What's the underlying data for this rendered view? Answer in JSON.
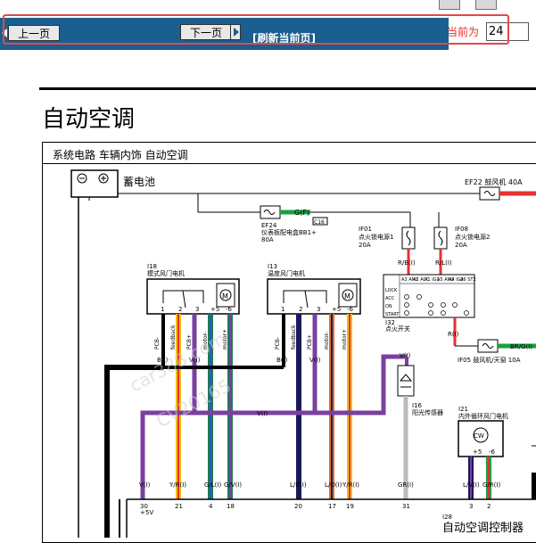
{
  "nav": {
    "prev_label": "上一页",
    "next_label": "下一页",
    "refresh_label": "[刷新当前页]",
    "current_label": "当前为",
    "page_value": "24"
  },
  "page": {
    "title": "自动空调",
    "breadcrumb": "系统电路  车辆内饰  自动空调"
  },
  "diagram": {
    "battery": "蓄电池",
    "ef22": "EF22 鼓风机 40A",
    "ef24": "EF24",
    "ef24_desc": "仪表板配电盒BB1+",
    "ef24_amp": "80A",
    "gf": "G(F)",
    "c16": "C16",
    "if01": "IF01",
    "if01_desc": "点火锁电源1",
    "if01_amp": "20A",
    "if08": "IF08",
    "if08_desc": "点火锁电源2",
    "if08_amp": "20A",
    "rb": "R/B(I)",
    "rl": "R/L(I)",
    "i18": "I18",
    "i18_desc": "模式风门电机",
    "i13": "I13",
    "i13_desc": "温度风门电机",
    "i32": "I32",
    "i32_desc": "点火开关",
    "ri": "R(I)",
    "brg": "BR/G(I)",
    "if05": "IF05 鼓风机/天窗 10A",
    "i16": "I16",
    "i16_desc": "阳光传感器",
    "i21": "I21",
    "i21_desc": "内外循环风门电机",
    "i28": "I28",
    "ecu": "自动空调控制器",
    "watermark1": "car388.com",
    "watermark2": "CV20165",
    "vi": "V(I)",
    "bi": "B(I)",
    "gri": "GR(I)",
    "wire_left": [
      "V(I)",
      "Y/R(I)",
      "G/L(I)",
      "G/V(I)"
    ],
    "wire_mid": [
      "L/B(I)",
      "L/O(I)",
      "Y/R(I)"
    ],
    "wire_right": [
      "GR(I)"
    ],
    "wire_far": [
      "L/V(I)",
      "G/R(I)"
    ],
    "pins_left": [
      "30",
      "21",
      "4",
      "18"
    ],
    "pin30_sub": "+5V",
    "pins_mid": [
      "20",
      "17",
      "19"
    ],
    "pins_right": [
      "31"
    ],
    "pins_far": [
      "3",
      "2"
    ],
    "motor_pins": [
      "1",
      "2",
      "3",
      "+5",
      "-6"
    ],
    "motor_labels": [
      "PCB-",
      "feedback",
      "PCB+",
      "motor-",
      "motor+"
    ],
    "switch_rows": [
      "LOCK",
      "ACC",
      "ON",
      "START"
    ],
    "switch_cols": [
      "A3 AM1",
      "A2 ACC",
      "A1 IG1",
      "A5 AM2",
      "A4 IG2",
      "A6 ST2"
    ],
    "cw": "CW",
    "m": "M",
    "i21_pins": [
      "+5",
      "-6"
    ]
  },
  "colors": {
    "nav_bar": "#1a5f8f",
    "highlight_frame": "#e04a4a",
    "current_label": "#e0302a"
  }
}
